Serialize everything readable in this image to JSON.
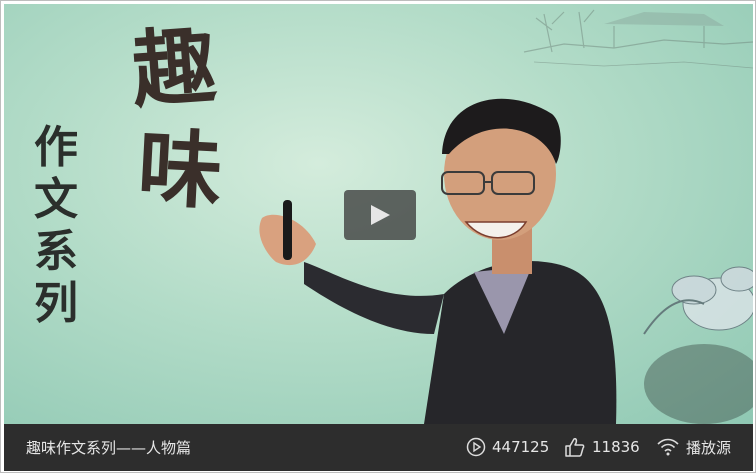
{
  "video": {
    "vertical_title": [
      "作",
      "文",
      "系",
      "列"
    ],
    "calligraphy": [
      "趣",
      "味"
    ],
    "title": "趣味作文系列——人物篇"
  },
  "stats": {
    "views": "447125",
    "likes": "11836",
    "source_label": "播放源"
  },
  "icons": {
    "play": "play-icon",
    "views": "play-circle-icon",
    "likes": "thumbs-up-icon",
    "source": "wifi-signal-icon"
  },
  "colors": {
    "bar_background": "#2d2d2d",
    "video_background": "#b3dcc8",
    "play_button": "#3c3c3c"
  }
}
